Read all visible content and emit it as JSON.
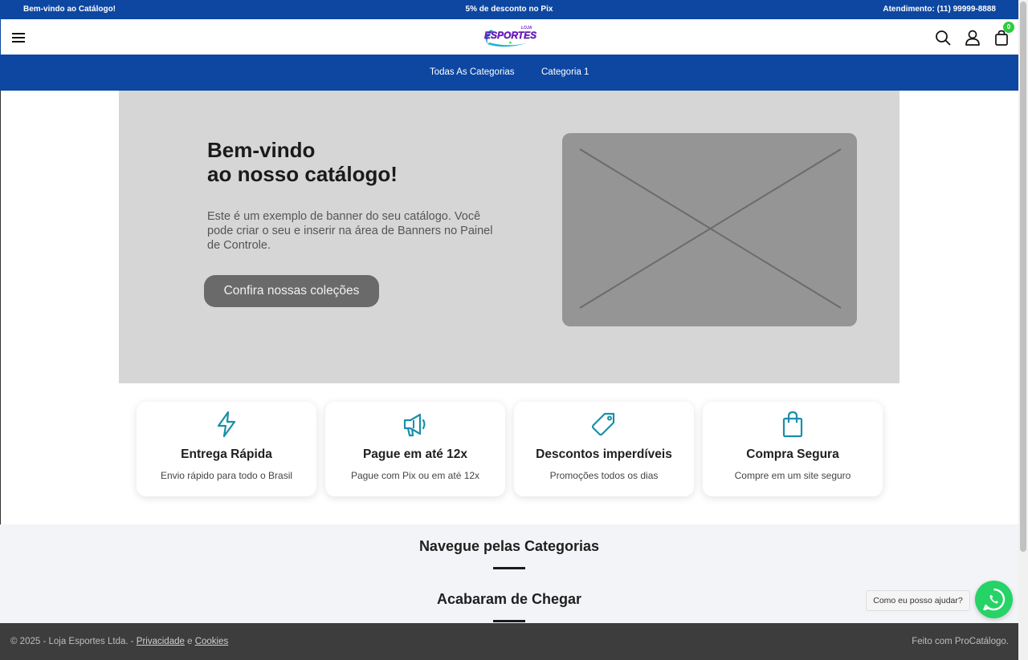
{
  "topbar": {
    "welcome": "Bem-vindo ao Catálogo!",
    "promo": "5% de desconto no Pix",
    "support": "Atendimento: (11) 99999-8888"
  },
  "header": {
    "logo_small": "LOJA",
    "logo_main": "ESPORTES",
    "cart_count": "0",
    "icons": [
      "menu-icon",
      "search-icon",
      "user-icon",
      "shopping-bag-icon"
    ]
  },
  "nav": {
    "items": [
      "Todas As Categorias",
      "Categoria 1"
    ]
  },
  "banner": {
    "title_line1": "Bem-vindo",
    "title_line2": "ao nosso catálogo!",
    "text": "Este é um exemplo de banner do seu catálogo. Você pode criar o seu e inserir na área de Banners no Painel de Controle.",
    "cta": "Confira nossas coleções"
  },
  "features": [
    {
      "title": "Entrega Rápida",
      "desc": "Envio rápido para todo o Brasil",
      "icon": "lightning-icon"
    },
    {
      "title": "Pague em até 12x",
      "desc": "Pague com Pix ou em até 12x",
      "icon": "megaphone-icon"
    },
    {
      "title": "Descontos imperdíveis",
      "desc": "Promoções todos os dias",
      "icon": "tag-icon"
    },
    {
      "title": "Compra Segura",
      "desc": "Compre em um site seguro",
      "icon": "shopping-bag-icon"
    }
  ],
  "sections": {
    "categories": "Navegue pelas Categorias",
    "new_arrivals": "Acabaram de Chegar"
  },
  "chat": {
    "bubble": "Como eu posso ajudar?",
    "icon": "whatsapp-icon"
  },
  "footer": {
    "copyright": "© 2025 - Loja Esportes Ltda. - ",
    "privacy": "Privacidade",
    "and": " e ",
    "cookies": "Cookies",
    "made_with": "Feito com ProCatálogo."
  },
  "colors": {
    "primary": "#0d47a1",
    "accent": "#1a8fa8",
    "whatsapp": "#25d366",
    "footer": "#3d3d3d"
  }
}
